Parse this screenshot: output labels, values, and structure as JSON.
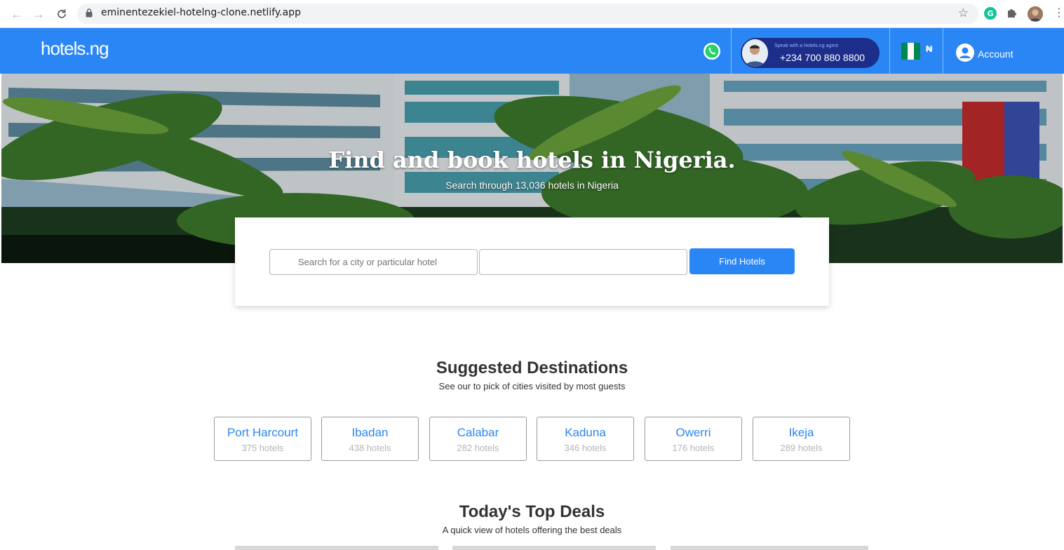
{
  "browser": {
    "url": "eminentezekiel-hotelng-clone.netlify.app"
  },
  "header": {
    "logo": "hotels.ng",
    "phone_caption": "Speak with a Hotels.ng agent",
    "phone_number": "+234 700 880 8800",
    "currency": "₦",
    "account_label": "Account",
    "brand_color": "#2a86f5",
    "pill_color": "#1c2e8a"
  },
  "hero": {
    "title": "Find and book hotels in Nigeria.",
    "subtitle": "Search through 13,036 hotels in Nigeria"
  },
  "search": {
    "city_placeholder": "Search for a city or particular hotel",
    "date_placeholder": "",
    "button_label": "Find Hotels"
  },
  "destinations": {
    "title": "Suggested Destinations",
    "subtitle": "See our to pick of cities visited by most guests",
    "items": [
      {
        "name": "Port Harcourt",
        "count": "375 hotels"
      },
      {
        "name": "Ibadan",
        "count": "438 hotels"
      },
      {
        "name": "Calabar",
        "count": "282 hotels"
      },
      {
        "name": "Kaduna",
        "count": "346 hotels"
      },
      {
        "name": "Owerri",
        "count": "176 hotels"
      },
      {
        "name": "Ikeja",
        "count": "289 hotels"
      }
    ]
  },
  "deals": {
    "title": "Today's Top Deals",
    "subtitle": "A quick view of hotels offering the best deals"
  }
}
